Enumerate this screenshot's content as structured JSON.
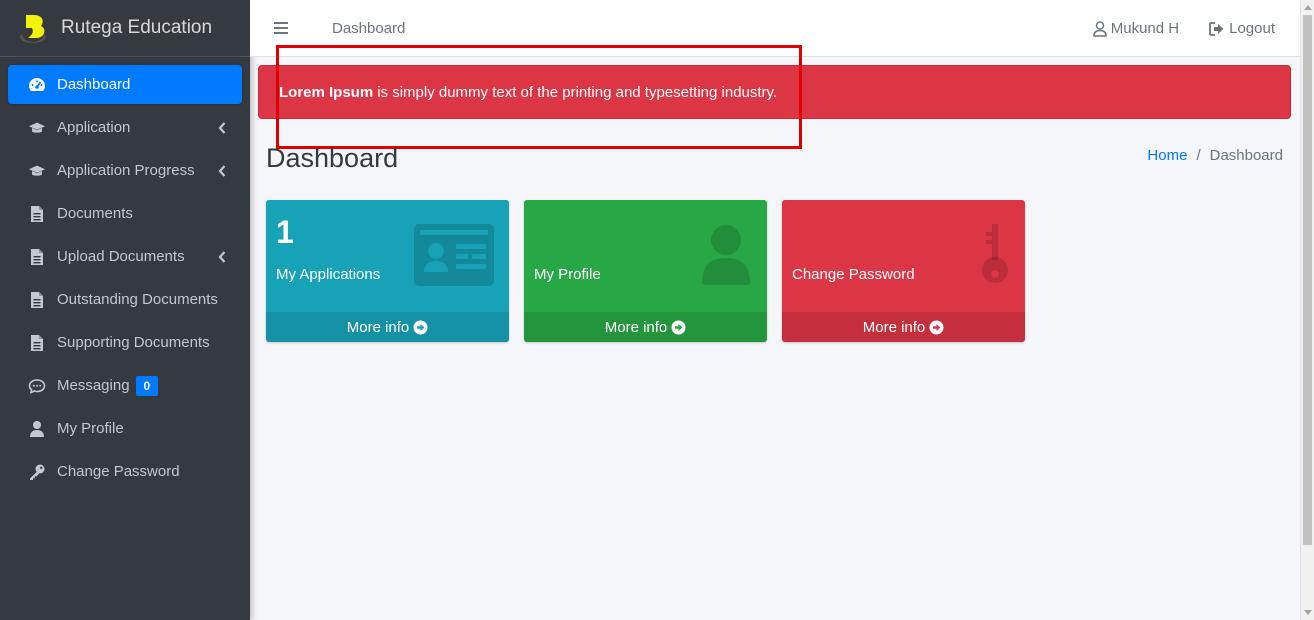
{
  "brand": {
    "name": "Rutega Education",
    "logo_color": "#f2f20a"
  },
  "sidebar": {
    "items": [
      {
        "label": "Dashboard",
        "icon": "tachometer-icon",
        "active": true
      },
      {
        "label": "Application",
        "icon": "graduation-cap-icon",
        "has_submenu": true
      },
      {
        "label": "Application Progress",
        "icon": "graduation-cap-icon",
        "has_submenu": true
      },
      {
        "label": "Documents",
        "icon": "file-icon"
      },
      {
        "label": "Upload Documents",
        "icon": "file-icon",
        "has_submenu": true
      },
      {
        "label": "Outstanding Documents",
        "icon": "file-icon"
      },
      {
        "label": "Supporting Documents",
        "icon": "file-icon"
      },
      {
        "label": "Messaging",
        "icon": "comments-icon",
        "badge": "0"
      },
      {
        "label": "My Profile",
        "icon": "user-icon"
      },
      {
        "label": "Change Password",
        "icon": "key-icon"
      }
    ]
  },
  "topbar": {
    "nav_link": "Dashboard",
    "user_name": "Mukund H",
    "logout_label": "Logout"
  },
  "alert": {
    "bold": "Lorem Ipsum",
    "text": "is simply dummy text of the printing and typesetting industry."
  },
  "page": {
    "title": "Dashboard",
    "breadcrumb": {
      "home": "Home",
      "current": "Dashboard"
    }
  },
  "boxes": [
    {
      "number": "1",
      "label": "My Applications",
      "footer": "More info",
      "color": "#17a2b8",
      "icon": "id-card-icon"
    },
    {
      "number": "",
      "label": "My Profile",
      "footer": "More info",
      "color": "#28a745",
      "icon": "user-icon"
    },
    {
      "number": "",
      "label": "Change Password",
      "footer": "More info",
      "color": "#dc3545",
      "icon": "key-icon"
    }
  ]
}
